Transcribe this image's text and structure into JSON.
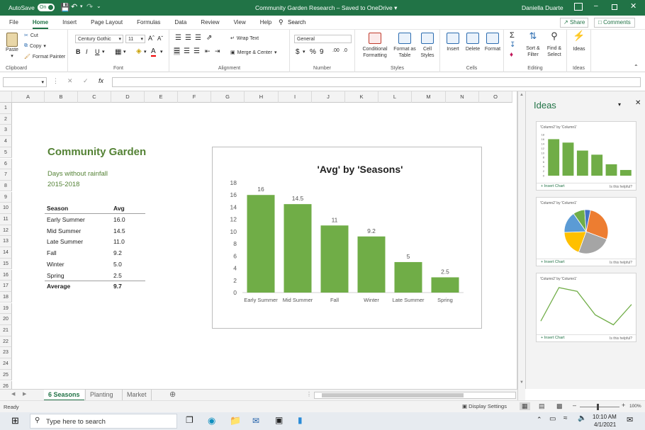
{
  "titlebar": {
    "autosave_label": "AutoSave",
    "autosave_state": "On",
    "doc_title": "Community Garden Research – Saved to OneDrive",
    "user": "Daniella Duarte"
  },
  "menu_tabs": [
    "File",
    "Home",
    "Insert",
    "Page Layout",
    "Formulas",
    "Data",
    "Review",
    "View",
    "Help"
  ],
  "search_label": "Search",
  "share_label": "Share",
  "comments_label": "Comments",
  "ribbon": {
    "clipboard": {
      "paste": "Paste",
      "cut": "Cut",
      "copy": "Copy",
      "format_painter": "Format Painter",
      "label": "Clipboard"
    },
    "font": {
      "name": "Century Gothic",
      "size": "11",
      "label": "Font"
    },
    "alignment": {
      "wrap": "Wrap Text",
      "merge": "Merge & Center",
      "label": "Alignment"
    },
    "number": {
      "format": "General",
      "label": "Number"
    },
    "styles": {
      "conditional": "Conditional\nFormatting",
      "table": "Format as\nTable",
      "cell": "Cell\nStyles",
      "label": "Styles"
    },
    "cells": {
      "insert": "Insert",
      "delete": "Delete",
      "format": "Format",
      "label": "Cells"
    },
    "editing": {
      "sort": "Sort &\nFilter",
      "find": "Find &\nSelect",
      "label": "Editing"
    },
    "ideas": {
      "btn": "Ideas",
      "label": "Ideas"
    }
  },
  "formula": {
    "fx": "fx"
  },
  "columns": [
    "A",
    "B",
    "C",
    "D",
    "E",
    "F",
    "G",
    "H",
    "I",
    "J",
    "K",
    "L",
    "M",
    "N",
    "O"
  ],
  "rows": [
    "1",
    "2",
    "3",
    "4",
    "5",
    "6",
    "7",
    "8",
    "9",
    "10",
    "11",
    "12",
    "13",
    "14",
    "15",
    "16",
    "17",
    "18",
    "19",
    "20",
    "21",
    "22",
    "23",
    "24",
    "25",
    "26"
  ],
  "sheet": {
    "title": "Community Garden",
    "subtitle1": "Days without rainfall",
    "subtitle2": "2015-2018",
    "header_season": "Season",
    "header_avg": "Avg",
    "rows": [
      {
        "season": "Early Summer",
        "avg": "16.0"
      },
      {
        "season": "Mid Summer",
        "avg": "14.5"
      },
      {
        "season": "Late Summer",
        "avg": "11.0"
      },
      {
        "season": "Fall",
        "avg": "9.2"
      },
      {
        "season": "Winter",
        "avg": "5.0"
      },
      {
        "season": "Spring",
        "avg": "2.5"
      }
    ],
    "total_label": "Average",
    "total_value": "9.7"
  },
  "chart_data": [
    {
      "type": "bar",
      "title": "'Avg' by 'Seasons'",
      "categories": [
        "Early Summer",
        "Mid Summer",
        "Fall",
        "Winter",
        "Late Summer",
        "Spring"
      ],
      "values": [
        16,
        14.5,
        11,
        9.2,
        5,
        2.5
      ],
      "data_labels": [
        "16",
        "14.5",
        "11",
        "9.2",
        "5",
        "2.5"
      ],
      "yticks": [
        "0",
        "2",
        "4",
        "6",
        "8",
        "10",
        "12",
        "14",
        "16",
        "18"
      ],
      "ylim": [
        0,
        18
      ],
      "color": "#70ad47",
      "grid": false
    },
    {
      "type": "bar",
      "title": "'Column2' by 'Column1'",
      "values": [
        16,
        14.5,
        11,
        9.2,
        5,
        2.5
      ],
      "yticks": [
        "0",
        "2",
        "4",
        "6",
        "8",
        "10",
        "12",
        "14",
        "16",
        "18"
      ],
      "ylim": [
        0,
        18
      ],
      "color": "#70ad47"
    },
    {
      "type": "pie",
      "title": "'Column2' by 'Column1'",
      "values": [
        16,
        14.5,
        11,
        9.2,
        5,
        2.5
      ],
      "colors": [
        "#ed7d31",
        "#a5a5a5",
        "#ffc000",
        "#5b9bd5",
        "#70ad47",
        "#4472c4"
      ]
    },
    {
      "type": "line",
      "title": "'Column2' by 'Column1'",
      "values": [
        2.5,
        16,
        14.5,
        5,
        1,
        9.2
      ],
      "color": "#70ad47"
    }
  ],
  "ideas_panel": {
    "title": "Ideas",
    "insert_chart": "Insert Chart",
    "helpful": "Is this helpful?"
  },
  "sheet_tabs": [
    "6 Seasons",
    "Planting",
    "Market"
  ],
  "status": {
    "ready": "Ready",
    "display_settings": "Display Settings",
    "zoom": "100%"
  },
  "taskbar": {
    "search_placeholder": "Type here to search",
    "time": "10:10 AM",
    "date": "4/1/2021"
  }
}
